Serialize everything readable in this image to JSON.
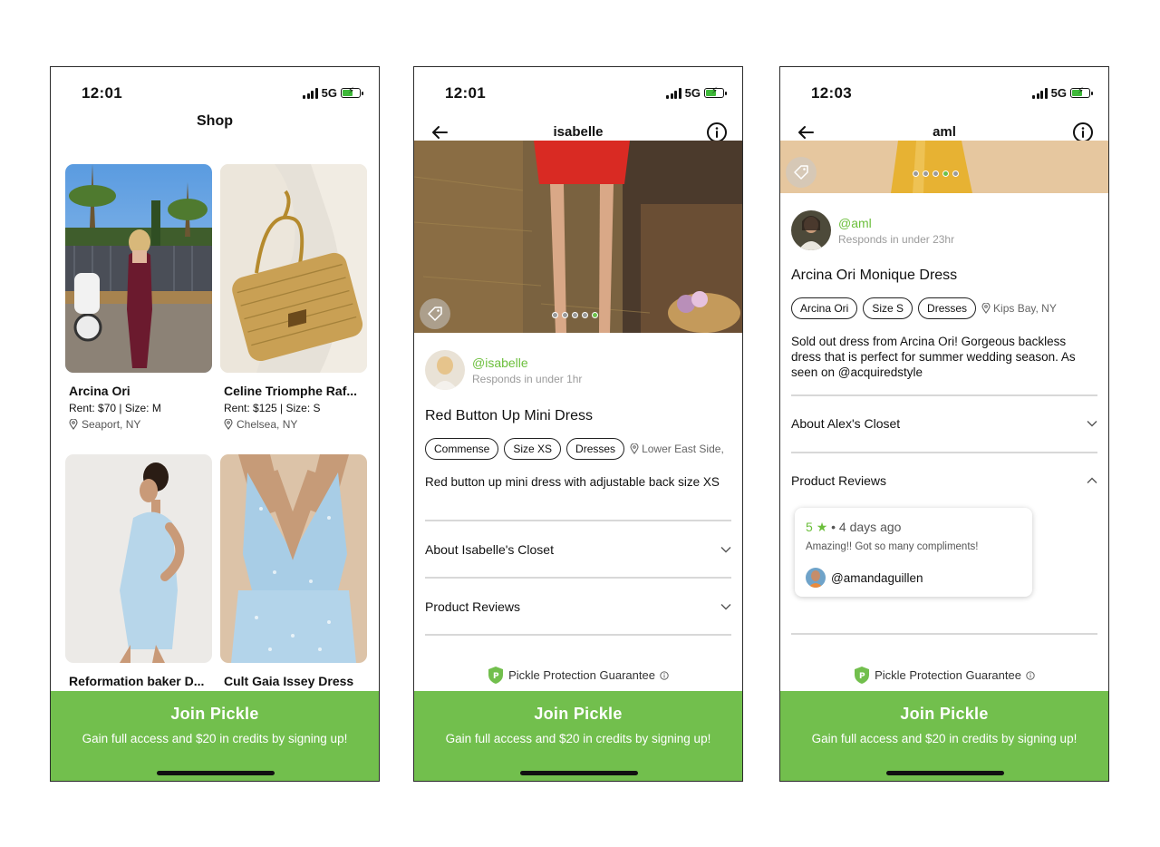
{
  "status": [
    {
      "time": "12:01",
      "network": "5G"
    },
    {
      "time": "12:01",
      "network": "5G"
    },
    {
      "time": "12:03",
      "network": "5G"
    }
  ],
  "shop": {
    "title": "Shop",
    "items": [
      {
        "name": "Arcina Ori",
        "price": "Rent: $70 | Size: M",
        "location": "Seaport, NY"
      },
      {
        "name": "Celine Triomphe Raf...",
        "price": "Rent: $125 | Size: S",
        "location": "Chelsea, NY"
      },
      {
        "name": "Reformation baker D..."
      },
      {
        "name": "Cult Gaia Issey Dress"
      }
    ]
  },
  "listing1": {
    "header": "isabelle",
    "handle": "@isabelle",
    "response": "Responds in under 1hr",
    "title": "Red Button Up Mini Dress",
    "chips": [
      "Commense",
      "Size XS",
      "Dresses"
    ],
    "location": "Lower East Side,",
    "description": "Red button up mini dress with adjustable back size XS",
    "about": "About Isabelle's Closet",
    "reviews": "Product Reviews"
  },
  "listing2": {
    "header": "aml",
    "handle": "@aml",
    "response": "Responds in under 23hr",
    "title": "Arcina Ori Monique Dress",
    "chips": [
      "Arcina Ori",
      "Size S",
      "Dresses"
    ],
    "location": "Kips Bay, NY",
    "description": "Sold out dress from Arcina Ori! Gorgeous backless dress that is perfect for summer wedding season. As seen on @acquiredstyle",
    "about": "About Alex's Closet",
    "reviews": "Product Reviews",
    "review": {
      "rating": "5",
      "age": "• 4 days ago",
      "text": "Amazing!! Got so many compliments!",
      "user": "@amandaguillen"
    }
  },
  "guarantee": "Pickle Protection Guarantee",
  "banner": {
    "title": "Join Pickle",
    "subtitle": "Gain full access and $20 in credits by signing up!"
  },
  "colors": {
    "brand_green": "#72bf4d",
    "handle_green": "#6cbf3c"
  },
  "icons": [
    "back-arrow-icon",
    "info-icon",
    "tag-icon",
    "location-pin-icon",
    "chevron-down-icon",
    "chevron-up-icon",
    "star-icon",
    "shield-icon"
  ]
}
